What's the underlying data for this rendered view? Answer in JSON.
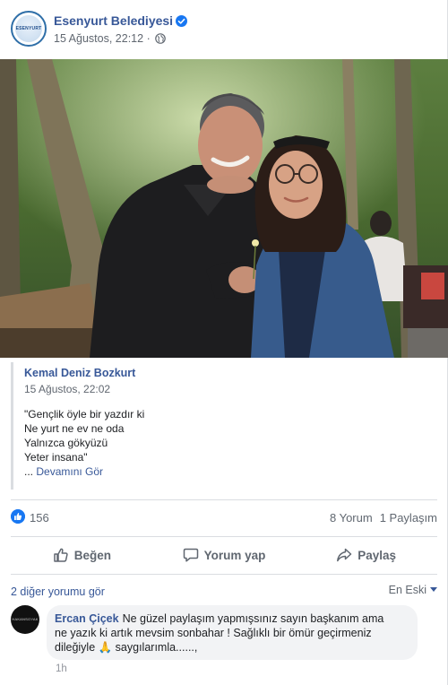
{
  "post": {
    "page_name": "Esenyurt Belediyesi",
    "date": "15 Ağustos, 22:12",
    "privacy_icon": "globe-icon",
    "avatar_text": "ESENYURT"
  },
  "shared": {
    "author": "Kemal Deniz Bozkurt",
    "date": "15 Ağustos, 22:02",
    "lines": [
      "\"Gençlik öyle bir yazdır ki",
      "Ne yurt ne ev ne oda",
      "Yalnızca gökyüzü",
      "Yeter insana\""
    ],
    "ellipsis": "...",
    "more_label": "Devamını Gör"
  },
  "reactions": {
    "like_count": "156",
    "comments": "8 Yorum",
    "shares": "1 Paylaşım"
  },
  "actions": {
    "like": "Beğen",
    "comment": "Yorum yap",
    "share": "Paylaş"
  },
  "comments": {
    "more_label": "2 diğer yorumu gör",
    "sort_label": "En Eski",
    "items": [
      {
        "author": "Ercan Çiçek",
        "avatar_text": "HAKANSOYAK",
        "text_1": "Ne güzel paylaşım yapmışsınız sayın başkanım ama",
        "text_2": "ne yazık ki artık mevsim sonbahar ! Sağlıklı bir ömür geçirmeniz",
        "text_3": "dileğiyle 🙏 saygılarımla......,",
        "time": "1h"
      }
    ]
  },
  "colors": {
    "link": "#385898",
    "meta": "#606770",
    "like_blue": "#1877f2",
    "divider": "#dadde1"
  }
}
